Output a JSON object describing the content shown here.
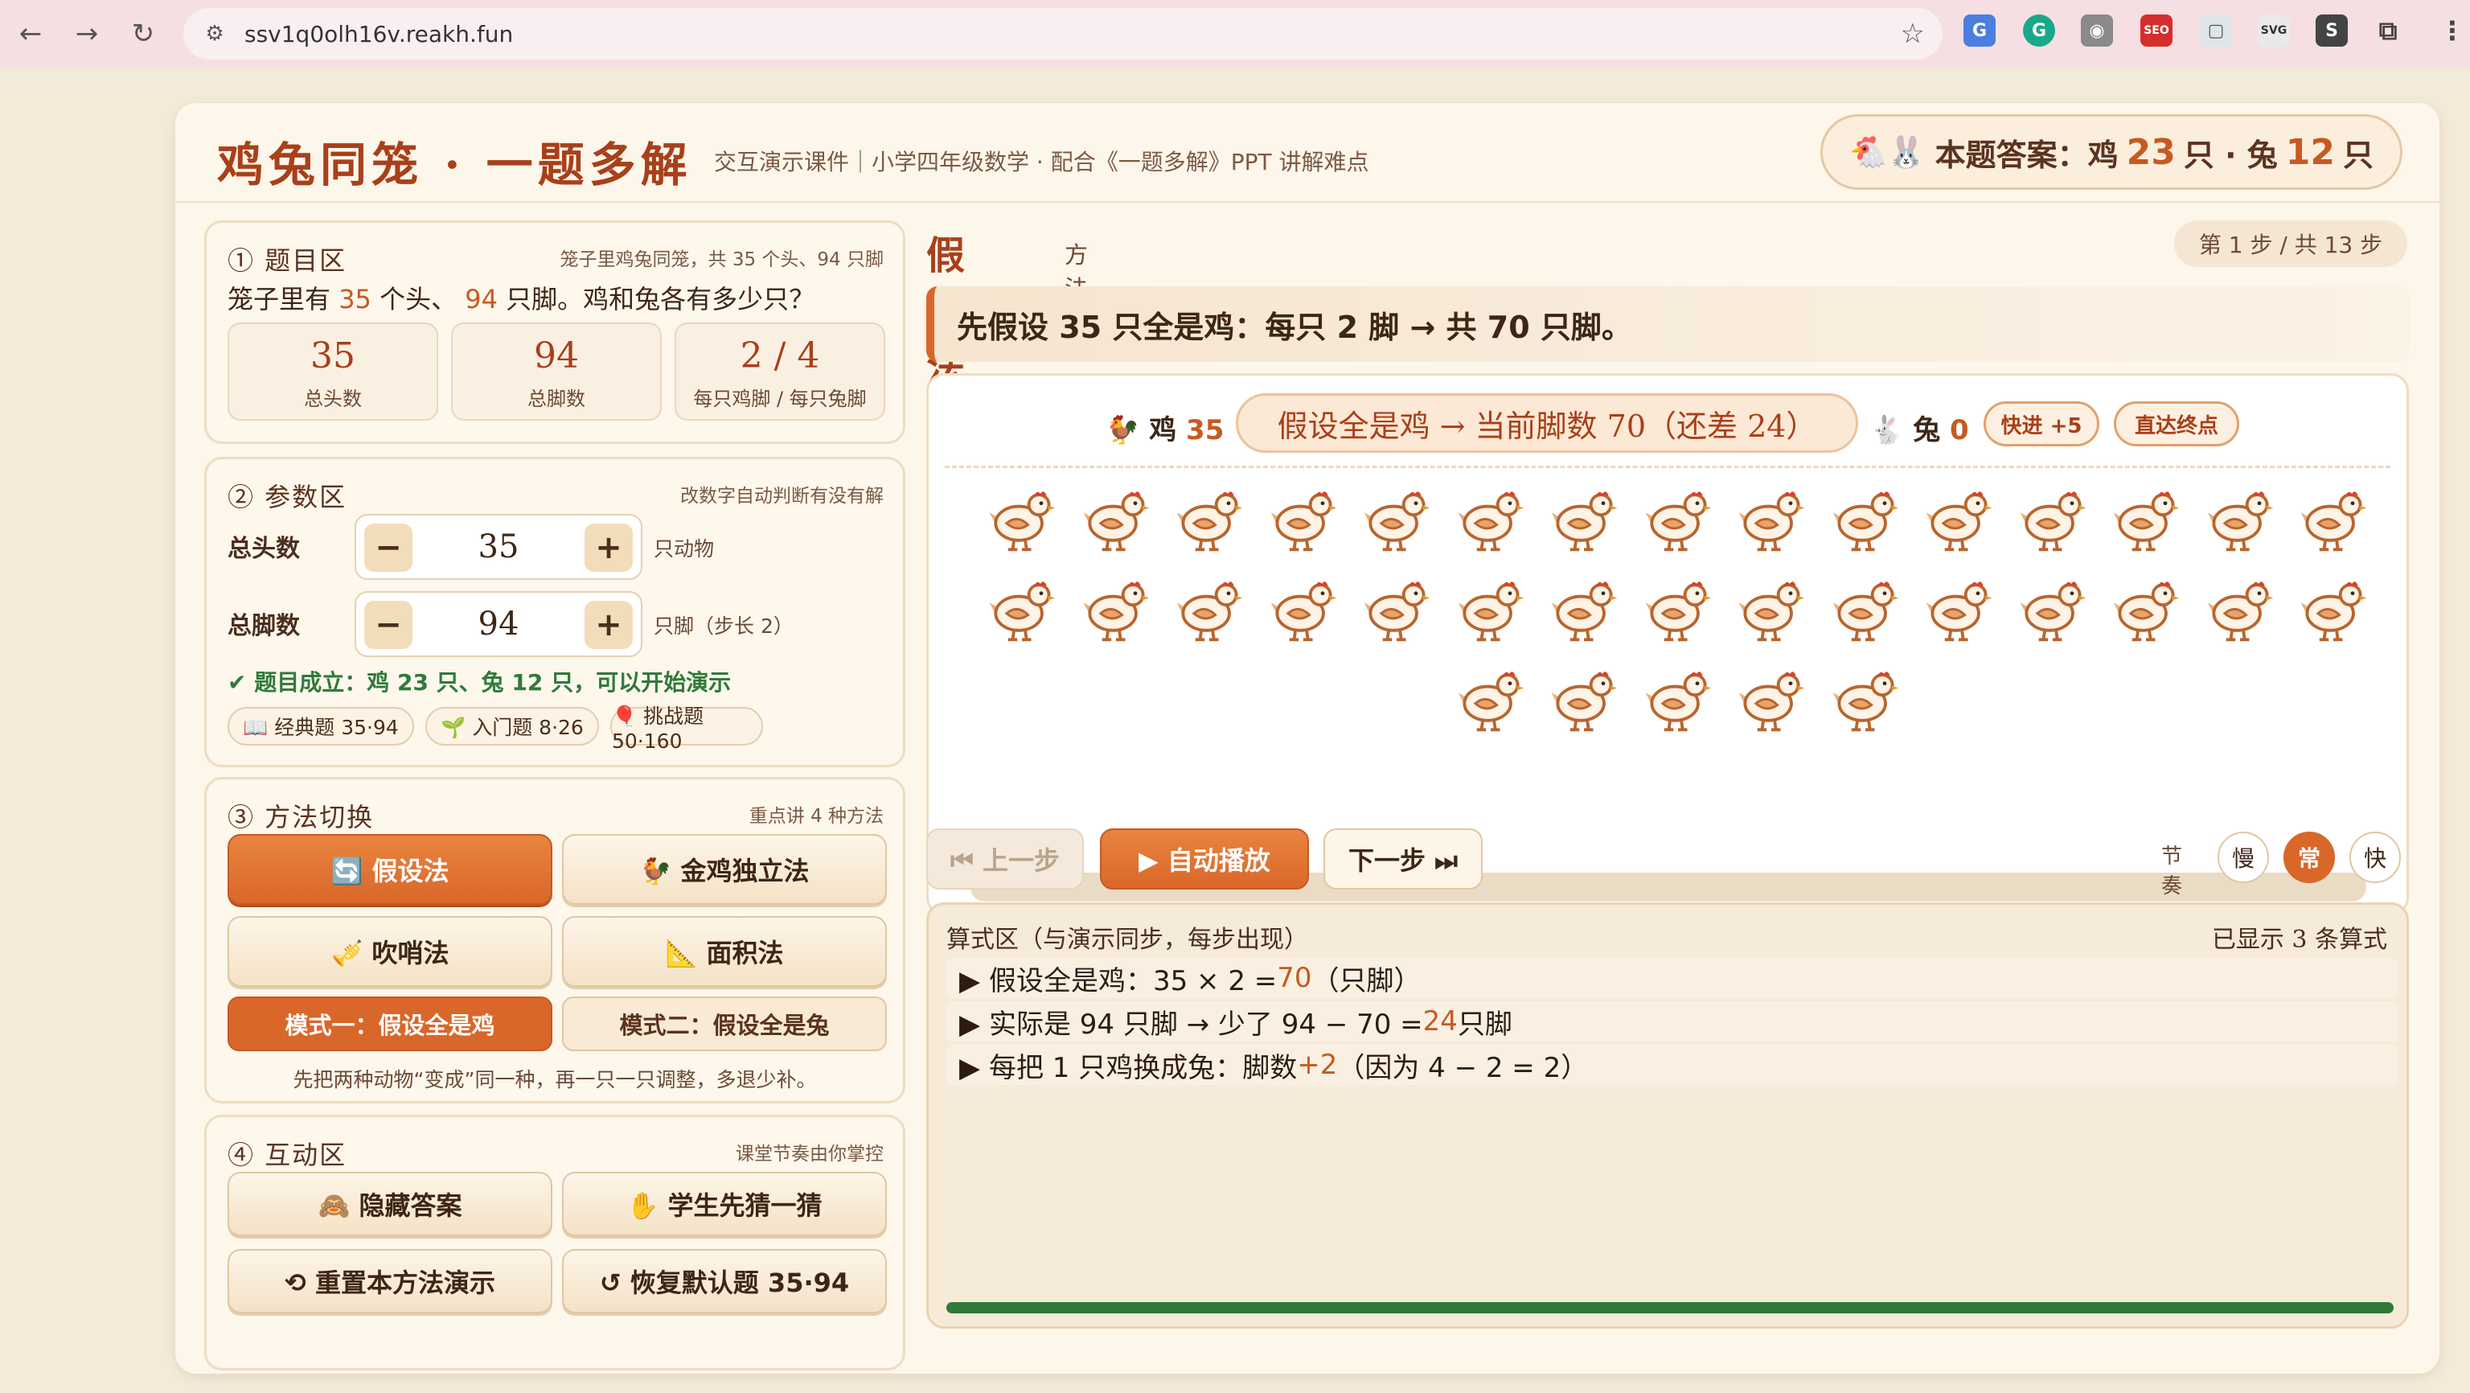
{
  "browser": {
    "url": "ssv1q0olh16v.reakh.fun"
  },
  "header": {
    "title": "鸡兔同笼 · 一题多解",
    "subtitle": "交互演示课件｜小学四年级数学 · 配合《一题多解》PPT 讲解难点",
    "answer_label": "本题答案：鸡",
    "answer_chicken": "23",
    "answer_mid": "只 · 兔",
    "answer_rabbit": "12",
    "answer_end": "只"
  },
  "problem": {
    "title": "① 题目区",
    "note": "笼子里鸡兔同笼，共 35 个头、94 只脚",
    "q_pre": "笼子里有",
    "heads": "35",
    "q_mid": "个头、",
    "legs": "94",
    "q_post": "只脚。鸡和兔各有多少只？",
    "stats": [
      {
        "value": "35",
        "label": "总头数"
      },
      {
        "value": "94",
        "label": "总脚数"
      },
      {
        "value": "2 / 4",
        "label": "每只鸡脚 / 每只兔脚"
      }
    ]
  },
  "params": {
    "title": "② 参数区",
    "note": "改数字自动判断有没有解",
    "heads_label": "总头数",
    "heads_value": "35",
    "heads_unit": "只动物",
    "legs_label": "总脚数",
    "legs_value": "94",
    "legs_unit": "只脚（步长 2）",
    "minus": "−",
    "plus": "+",
    "status": "✔ 题目成立：鸡 23 只、兔 12 只，可以开始演示",
    "presets": [
      "📖 经典题 35·94",
      "🌱 入门题 8·26",
      "🎈 挑战题 50·160"
    ]
  },
  "methods": {
    "title": "③ 方法切换",
    "note": "重点讲 4 种方法",
    "buttons": [
      "🔄 假设法",
      "🐓 金鸡独立法",
      "🎺 吹哨法",
      "📐 面积法"
    ],
    "modes": [
      "模式一：假设全是鸡",
      "模式二：假设全是兔"
    ],
    "hint": "先把两种动物“变成”同一种，再一只一只调整，多退少补。"
  },
  "interact": {
    "title": "④ 互动区",
    "note": "课堂节奏由你掌控",
    "buttons": [
      "🙈 隐藏答案",
      "✋ 学生先猜一猜",
      "⟲ 重置本方法演示",
      "↺ 恢复默认题 35·94"
    ]
  },
  "stage": {
    "method_title": "假设法",
    "method_sub": "方法一",
    "step": "第 1 步 / 共 13 步",
    "explanation": "先假设  35  只全是鸡：每只 2 脚 → 共  70  只脚。",
    "chicken_label": "鸡",
    "chicken_count": "35",
    "state": "假设全是鸡 → 当前脚数 70（还差 24）",
    "rabbit_label": "兔",
    "rabbit_count": "0",
    "fast_label": "快进 +5",
    "end_label": "直达终点",
    "chickens_shown": 35
  },
  "controls": {
    "prev": "⏮ 上一步",
    "play": "▶ 自动播放",
    "next": "下一步 ⏭",
    "rhythm": "节奏",
    "speeds": [
      "慢",
      "常",
      "快"
    ],
    "active_speed": "常"
  },
  "formula": {
    "title": "算式区（与演示同步，每步出现）",
    "count": "已显示 3 条算式",
    "lines": [
      {
        "pre": "▶ 假设全是鸡：35 × 2 = ",
        "hi": "70",
        "post": "（只脚）"
      },
      {
        "pre": "▶ 实际是 94 只脚 → 少了 94 − 70 = ",
        "hi": "24",
        "post": " 只脚"
      },
      {
        "pre": "▶ 每把 1 只鸡换成兔：脚数 ",
        "hi": "+2",
        "post": "（因为 4 − 2 = 2）"
      }
    ],
    "progress": 1.0
  },
  "colors": {
    "accent": "#d9672a",
    "title": "#a8401a",
    "ok": "#2f7a3a"
  }
}
